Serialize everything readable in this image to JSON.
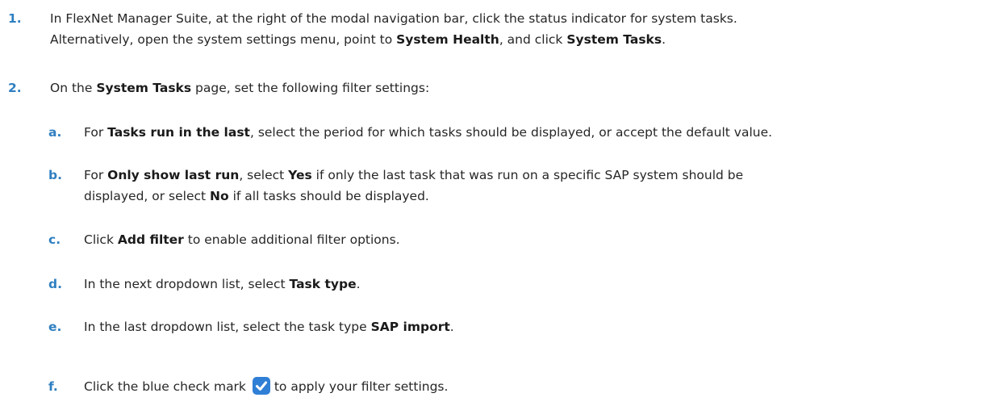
{
  "steps": [
    {
      "num": "1.",
      "line1": "In FlexNet Manager Suite, at the right of the modal navigation bar, click the status indicator for system tasks.",
      "line2_pre": "Alternatively, open the system settings menu, point to ",
      "line2_b1": "System Health",
      "line2_mid": ", and click ",
      "line2_b2": "System Tasks",
      "line2_post": "."
    },
    {
      "num": "2.",
      "pre": "On the ",
      "b1": "System Tasks",
      "post": " page, set the following filter settings:"
    }
  ],
  "substeps": {
    "a": {
      "num": "a.",
      "pre": "For ",
      "b1": "Tasks run in the last",
      "post": ", select the period for which tasks should be displayed, or accept the default value."
    },
    "b": {
      "num": "b.",
      "pre": "For ",
      "b1": "Only show last run",
      "mid": ", select ",
      "b2": "Yes",
      "post1": " if only the last task that was run on a specific SAP system should be",
      "line2_pre": "displayed, or select ",
      "line2_b": "No",
      "line2_post": " if all tasks should be displayed."
    },
    "c": {
      "num": "c.",
      "pre": "Click ",
      "b1": "Add filter",
      "post": " to enable additional filter options."
    },
    "d": {
      "num": "d.",
      "pre": "In the next dropdown list, select ",
      "b1": "Task type",
      "post": "."
    },
    "e": {
      "num": "e.",
      "pre": "In the last dropdown list, select the task type ",
      "b1": "SAP import",
      "post": "."
    },
    "f": {
      "num": "f.",
      "pre": "Click the blue check mark",
      "post": "to apply your filter settings.",
      "icon": "checkbox-checked-icon",
      "icon_color": "#2f7fd6"
    }
  }
}
